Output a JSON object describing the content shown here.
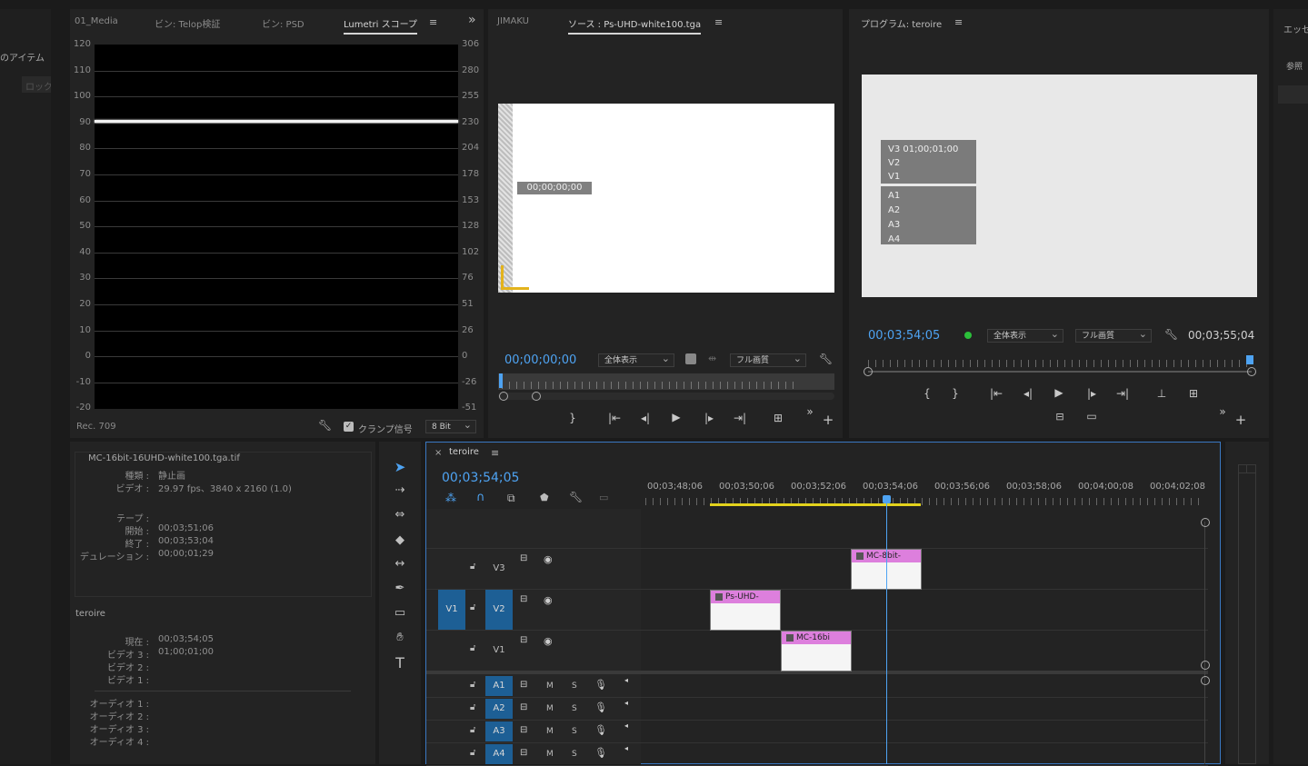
{
  "left_edge": {
    "item_text": "のアイテム",
    "lock_text": "ロック"
  },
  "scopes_panel": {
    "tabs": [
      "01_Media",
      "ビン: Telop検証",
      "ビン: PSD",
      "Lumetri スコープ"
    ],
    "active_tab": "Lumetri スコープ",
    "menu": "≡",
    "overflow": "»",
    "left_axis": [
      "120",
      "110",
      "100",
      "90",
      "80",
      "70",
      "60",
      "50",
      "40",
      "30",
      "20",
      "10",
      "0",
      "-10",
      "-20"
    ],
    "right_axis": [
      "306",
      "280",
      "255",
      "230",
      "204",
      "178",
      "153",
      "128",
      "102",
      "76",
      "51",
      "26",
      "0",
      "-26",
      "-51"
    ],
    "waveform_level": 91,
    "color_space": "Rec. 709",
    "clamp_label": "クランプ信号",
    "clamp_checked": true,
    "bit_depth": "8 Bit"
  },
  "source_panel": {
    "tab_jimaku": "JIMAKU",
    "tab_source": "ソース : Ps-UHD-white100.tga",
    "menu": "≡",
    "overlay_tc": "00;00;00;00",
    "timecode": "00;00;00;00",
    "zoom": "全体表示",
    "quality": "フル画質"
  },
  "program_panel": {
    "tab": "プログラム: teroire",
    "menu": "≡",
    "overlay_lines_video": [
      "V3 01;00;01;00",
      "V2",
      "V1"
    ],
    "overlay_lines_audio": [
      "A1",
      "A2",
      "A3",
      "A4"
    ],
    "timecode": "00;03;54;05",
    "zoom": "全体表示",
    "quality": "フル画質",
    "duration": "00;03;55;04"
  },
  "right_edge": {
    "label1": "エッセ",
    "label2": "参照"
  },
  "info_panel": {
    "clip_name": "MC-16bit-16UHD-white100.tga.tif",
    "rows1": [
      {
        "k": "種類 :",
        "v": "静止画"
      },
      {
        "k": "ビデオ :",
        "v": "29.97 fps、3840 x 2160 (1.0)"
      }
    ],
    "rows2": [
      {
        "k": "テープ :",
        "v": ""
      },
      {
        "k": "開始 :",
        "v": "00;03;51;06"
      },
      {
        "k": "終了 :",
        "v": "00;03;53;04"
      },
      {
        "k": "デュレーション :",
        "v": "00;00;01;29"
      }
    ],
    "sequence_name": "teroire",
    "rows3": [
      {
        "k": "現在 :",
        "v": "00;03;54;05"
      },
      {
        "k": "ビデオ 3 :",
        "v": "01;00;01;00"
      },
      {
        "k": "ビデオ 2 :",
        "v": ""
      },
      {
        "k": "ビデオ 1 :",
        "v": ""
      }
    ],
    "rows4": [
      {
        "k": "オーディオ 1 :",
        "v": ""
      },
      {
        "k": "オーディオ 2 :",
        "v": ""
      },
      {
        "k": "オーディオ 3 :",
        "v": ""
      },
      {
        "k": "オーディオ 4 :",
        "v": ""
      }
    ]
  },
  "timeline": {
    "tab": "teroire",
    "close": "×",
    "menu": "≡",
    "timecode": "00;03;54;05",
    "ruler": [
      "00;03;48;06",
      "00;03;50;06",
      "00;03;52;06",
      "00;03;54;06",
      "00;03;56;06",
      "00;03;58;06",
      "00;04;00;08",
      "00;04;02;08"
    ],
    "video_tracks": [
      {
        "src": "",
        "name": "V3"
      },
      {
        "src": "V1",
        "name": "V2"
      },
      {
        "src": "",
        "name": "V1"
      }
    ],
    "audio_tracks": [
      "A1",
      "A2",
      "A3",
      "A4"
    ],
    "mute": "M",
    "solo": "S",
    "clips": [
      {
        "label": "MC-8bit-"
      },
      {
        "label": "Ps-UHD-"
      },
      {
        "label": "MC-16bi"
      }
    ]
  },
  "colors": {
    "accent_blue": "#4ea3f2",
    "track_blue": "#1d5f95",
    "clip_pink": "#dd7fdd",
    "work_area_yellow": "#e3d21c"
  }
}
